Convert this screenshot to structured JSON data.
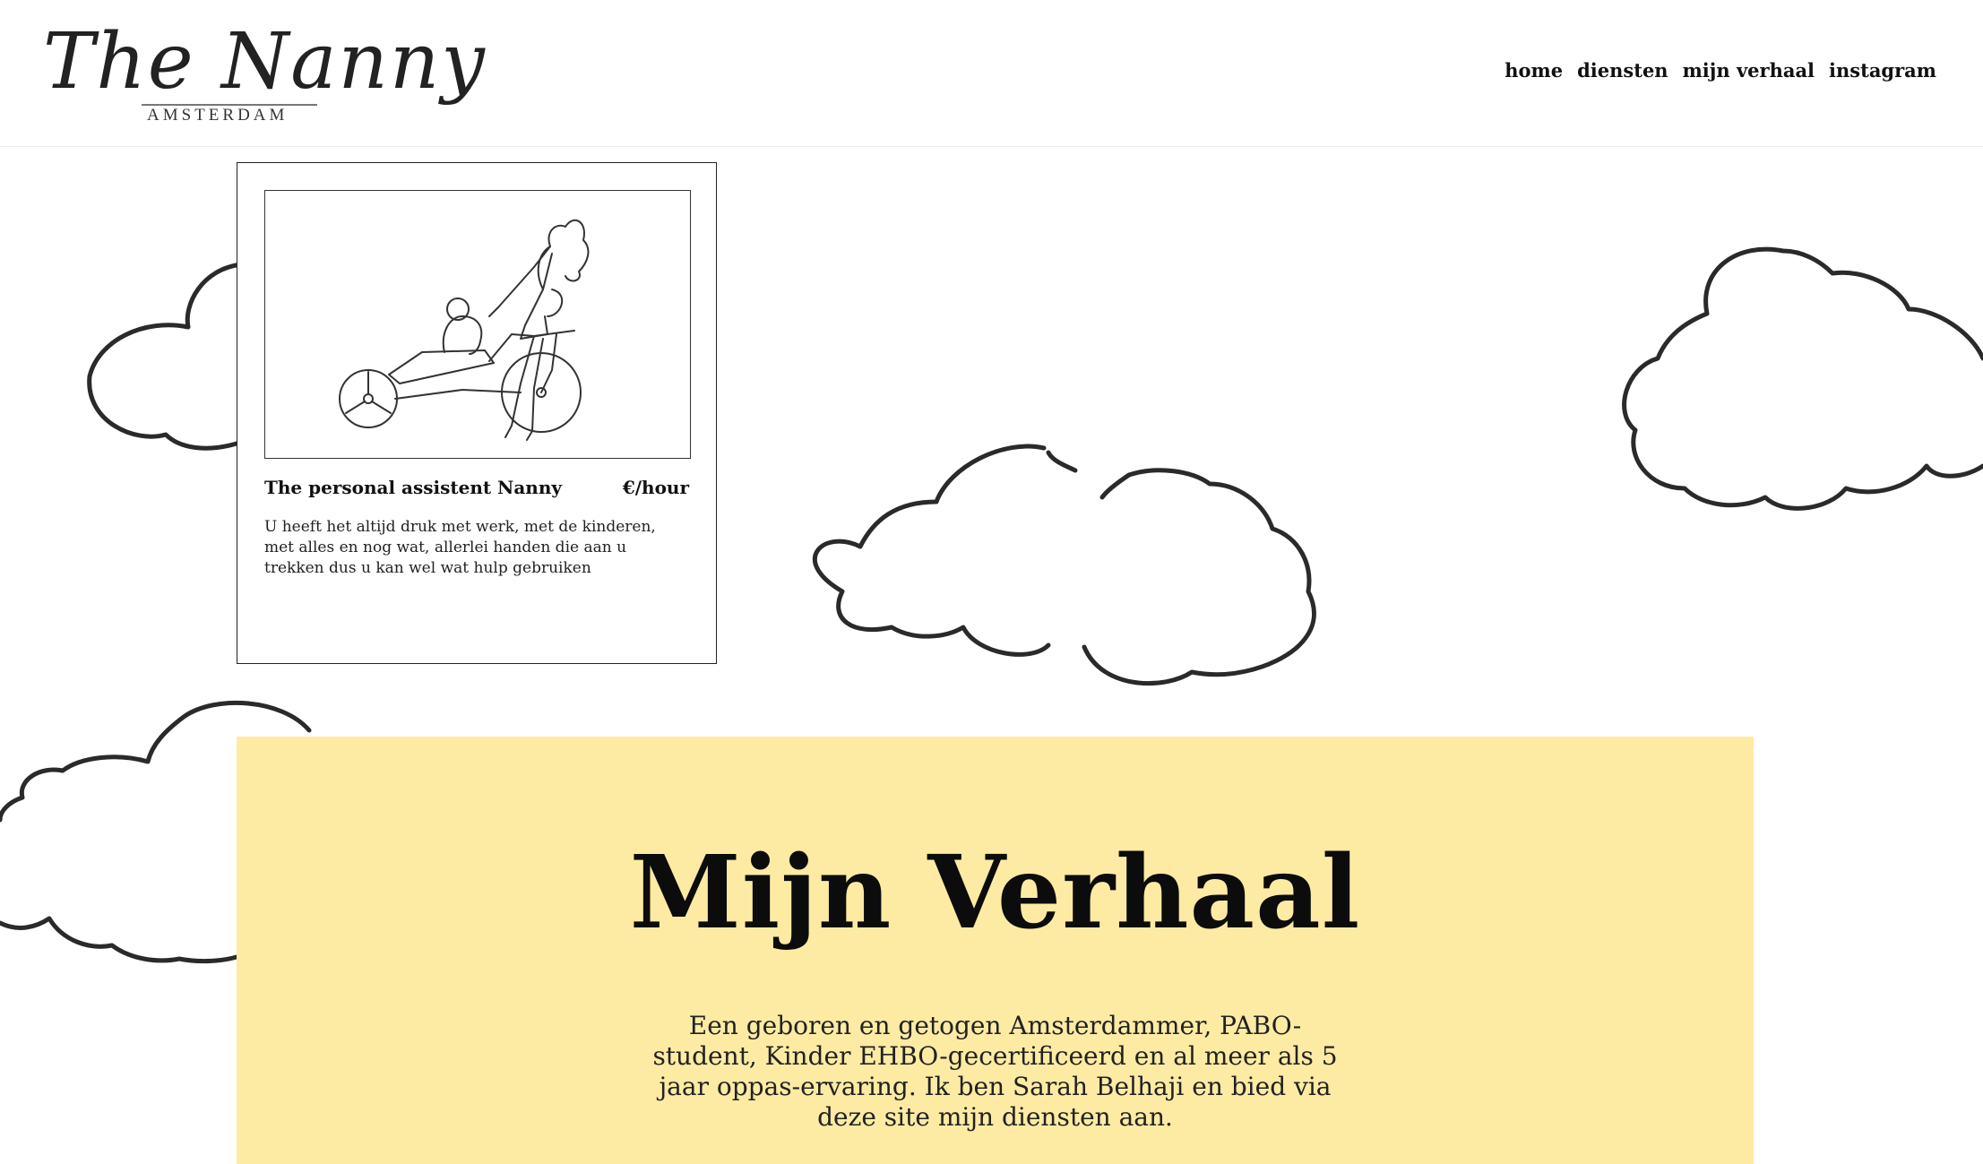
{
  "header": {
    "logo_script": "The Nanny",
    "logo_sub": "AMSTERDAM",
    "nav": [
      "home",
      "diensten",
      "mijn verhaal",
      "instagram"
    ]
  },
  "service_card": {
    "title": "The personal assistent Nanny",
    "price": "€/hour",
    "description": "U heeft het altijd druk met werk, met de kinderen, met alles en nog wat, allerlei handen die aan u trekken dus u kan wel wat hulp gebruiken",
    "image": "nanny-on-cargo-bike-illustration"
  },
  "story": {
    "title": "Mijn Verhaal",
    "text": "Een geboren en getogen Amsterdammer, PABO-student, Kinder EHBO-gecertificeerd en al meer als 5 jaar oppas-ervaring. Ik ben Sarah Belhaji en bied via deze site mijn diensten aan.",
    "background": "#fdeba3"
  }
}
